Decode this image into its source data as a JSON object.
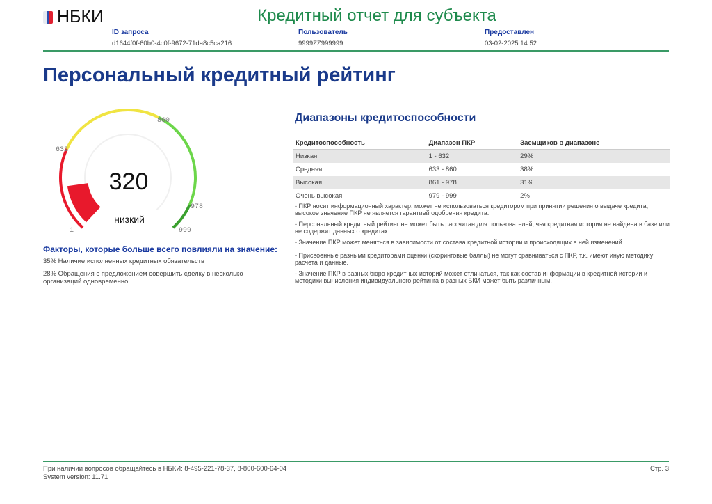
{
  "header": {
    "logo_text": "НБКИ",
    "title": "Кредитный отчет для субъекта",
    "meta": [
      {
        "label": "ID запроса",
        "value": "d1644f0f-60b0-4c0f-9672-71da8c5ca216"
      },
      {
        "label": "Пользователь",
        "value": "9999ZZ999999"
      },
      {
        "label": "Предоставлен",
        "value": "03-02-2025 14:52"
      }
    ]
  },
  "section_title": "Персональный кредитный рейтинг",
  "gauge": {
    "score": "320",
    "score_value": 320,
    "grade": "низкий",
    "ticks": [
      "1",
      "632",
      "860",
      "978",
      "999"
    ],
    "colors": {
      "low": "#e8192c",
      "medium": "#f0e442",
      "high": "#6cd64a",
      "very_high": "#3aa02e"
    }
  },
  "factors": {
    "title": "Факторы, которые больше всего повлияли на значение:",
    "items": [
      "35% Наличие исполненных кредитных обязательств",
      "28% Обращения с предложением совершить сделку в несколько организаций одновременно"
    ]
  },
  "ranges": {
    "title": "Диапазоны кредитоспособности",
    "headers": [
      "Кредитоспособность",
      "Диапазон ПКР",
      "Заемщиков в диапазоне"
    ],
    "rows": [
      [
        "Низкая",
        "1 - 632",
        "29%"
      ],
      [
        "Средняя",
        "633 - 860",
        "38%"
      ],
      [
        "Высокая",
        "861 - 978",
        "31%"
      ],
      [
        "Очень высокая",
        "979 - 999",
        "2%"
      ]
    ]
  },
  "notes": [
    "- ПКР носит информационный характер, может не использоваться кредитором при принятии решения о выдаче кредита, высокое значение ПКР не является гарантией одобрения кредита.",
    "- Персональный кредитный рейтинг не может быть рассчитан для пользователей, чья кредитная история не найдена в базе или не содержит данных о кредитах.",
    "- Значение ПКР может меняться в зависимости от состава кредитной истории и происходящих в ней изменений.",
    "- Присвоенные разными кредиторами оценки (скоринговые баллы) не могут сравниваться с ПКР, т.к. имеют иную методику расчета и данные.",
    "- Значение ПКР в разных бюро кредитных историй может отличаться, так как состав информации в кредитной истории и методики вычисления индивидуального рейтинга в разных БКИ может быть различным."
  ],
  "footer": {
    "contact": "При наличии вопросов обращайтесь в НБКИ: 8-495-221-78-37, 8-800-600-64-04",
    "version": "System version: 11.71",
    "page": "Стр. 3"
  }
}
